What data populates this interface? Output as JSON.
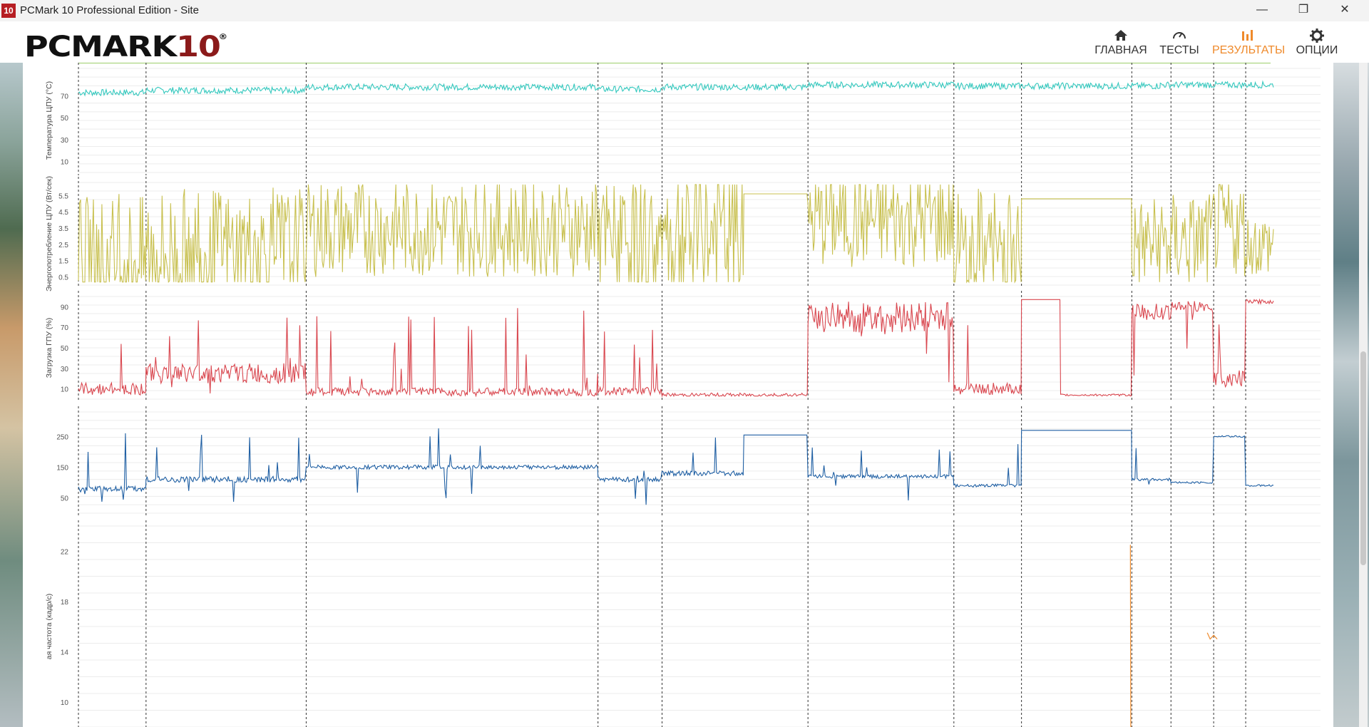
{
  "window": {
    "icon_text": "10",
    "title": "PCMark 10 Professional Edition - Site",
    "controls": [
      "—",
      "❐",
      "✕"
    ]
  },
  "header": {
    "logo": {
      "main": "PCMARK",
      "num": "10",
      "reg": "®"
    },
    "nav": [
      {
        "label": "ГЛАВНАЯ",
        "icon": "home-icon",
        "active": false
      },
      {
        "label": "ТЕСТЫ",
        "icon": "gauge-icon",
        "active": false
      },
      {
        "label": "РЕЗУЛЬТАТЫ",
        "icon": "bar-chart-icon",
        "active": true
      },
      {
        "label": "ОПЦИИ",
        "icon": "gear-icon",
        "active": false
      }
    ],
    "accent": "#ef8a2b"
  },
  "chart_data": [
    {
      "type": "line",
      "ylabel": "Температура ЦПУ (°C)",
      "yticks": [
        10,
        30,
        50,
        70
      ],
      "ylim": [
        0,
        95
      ],
      "xlim": [
        0,
        1680
      ],
      "color": "#34c8be",
      "segments": [
        [
          0,
          95,
          73,
          3
        ],
        [
          95,
          320,
          75,
          3
        ],
        [
          320,
          730,
          78,
          3
        ],
        [
          730,
          820,
          76,
          3
        ],
        [
          820,
          1025,
          78,
          3
        ],
        [
          1025,
          1230,
          80,
          3
        ],
        [
          1230,
          1520,
          79,
          3
        ],
        [
          1520,
          1680,
          80,
          3
        ]
      ],
      "markers": [
        0,
        95,
        320,
        730,
        820,
        1025,
        1230,
        1325,
        1480,
        1535,
        1595,
        1640
      ]
    },
    {
      "type": "line",
      "ylabel": "Энергопотребление ЦПУ (Вт/сек)",
      "yticks": [
        0.5,
        1.5,
        2.5,
        3.5,
        4.5,
        5.5
      ],
      "ylim": [
        0,
        6.3
      ],
      "xlim": [
        0,
        1680
      ],
      "color": "#c8c04f",
      "segments": [
        [
          0,
          95,
          1.5,
          4
        ],
        [
          95,
          320,
          2.0,
          4
        ],
        [
          320,
          730,
          3.5,
          3
        ],
        [
          730,
          820,
          2.5,
          4
        ],
        [
          820,
          935,
          3.0,
          5
        ],
        [
          935,
          1025,
          5.6,
          0
        ],
        [
          1025,
          1230,
          4.0,
          3
        ],
        [
          1230,
          1325,
          2.0,
          4
        ],
        [
          1325,
          1480,
          5.3,
          0
        ],
        [
          1480,
          1535,
          2.5,
          3
        ],
        [
          1535,
          1595,
          2.7,
          3
        ],
        [
          1595,
          1640,
          3.5,
          3
        ],
        [
          1640,
          1680,
          2.5,
          2
        ]
      ],
      "markers": [
        0,
        95,
        320,
        730,
        820,
        1025,
        1230,
        1325,
        1480,
        1535,
        1595,
        1640
      ]
    },
    {
      "type": "line",
      "ylabel": "Загрузка ГПУ (%)",
      "yticks": [
        10,
        30,
        50,
        70,
        90
      ],
      "ylim": [
        0,
        100
      ],
      "xlim": [
        0,
        1680
      ],
      "color": "#d9474f",
      "segments": [
        [
          0,
          95,
          10,
          6
        ],
        [
          95,
          320,
          25,
          10
        ],
        [
          320,
          730,
          7,
          4
        ],
        [
          730,
          820,
          8,
          4
        ],
        [
          820,
          1025,
          4,
          2
        ],
        [
          1025,
          1230,
          80,
          15
        ],
        [
          1230,
          1325,
          10,
          6
        ],
        [
          1325,
          1380,
          97,
          0
        ],
        [
          1380,
          1480,
          4,
          1
        ],
        [
          1480,
          1535,
          85,
          8
        ],
        [
          1535,
          1595,
          90,
          6
        ],
        [
          1595,
          1640,
          20,
          8
        ],
        [
          1640,
          1680,
          95,
          2
        ]
      ],
      "markers": [
        0,
        95,
        320,
        730,
        820,
        1025,
        1230,
        1325,
        1480,
        1535,
        1595,
        1640
      ]
    },
    {
      "type": "line",
      "ylabel": "",
      "yticks": [
        50,
        150,
        250
      ],
      "ylim": [
        0,
        330
      ],
      "xlim": [
        0,
        1680
      ],
      "color": "#1f5fa3",
      "segments": [
        [
          0,
          95,
          80,
          8
        ],
        [
          95,
          320,
          110,
          10
        ],
        [
          320,
          730,
          150,
          7
        ],
        [
          730,
          820,
          110,
          8
        ],
        [
          820,
          935,
          130,
          8
        ],
        [
          935,
          1025,
          255,
          0
        ],
        [
          1025,
          1230,
          120,
          6
        ],
        [
          1230,
          1325,
          90,
          5
        ],
        [
          1325,
          1480,
          270,
          0
        ],
        [
          1480,
          1535,
          110,
          4
        ],
        [
          1535,
          1595,
          100,
          3
        ],
        [
          1595,
          1640,
          250,
          3
        ],
        [
          1640,
          1680,
          90,
          3
        ]
      ],
      "markers": [
        0,
        95,
        320,
        730,
        820,
        1025,
        1230,
        1325,
        1480,
        1535,
        1595,
        1640
      ]
    },
    {
      "type": "line",
      "ylabel": "ая частота (кадр/с)",
      "yticks": [
        10,
        14,
        18,
        22
      ],
      "ylim": [
        8,
        24
      ],
      "xlim": [
        0,
        1680
      ],
      "color": "#ef8a2b",
      "points": [
        [
          1478,
          22.5
        ],
        [
          1478.5,
          8.0
        ],
        [
          1586,
          15.5
        ],
        [
          1590,
          15.0
        ],
        [
          1595,
          15.3
        ],
        [
          1600,
          15.0
        ]
      ],
      "markers": [
        0,
        95,
        320,
        730,
        820,
        1025,
        1230,
        1325,
        1480,
        1535,
        1595,
        1640
      ]
    }
  ]
}
